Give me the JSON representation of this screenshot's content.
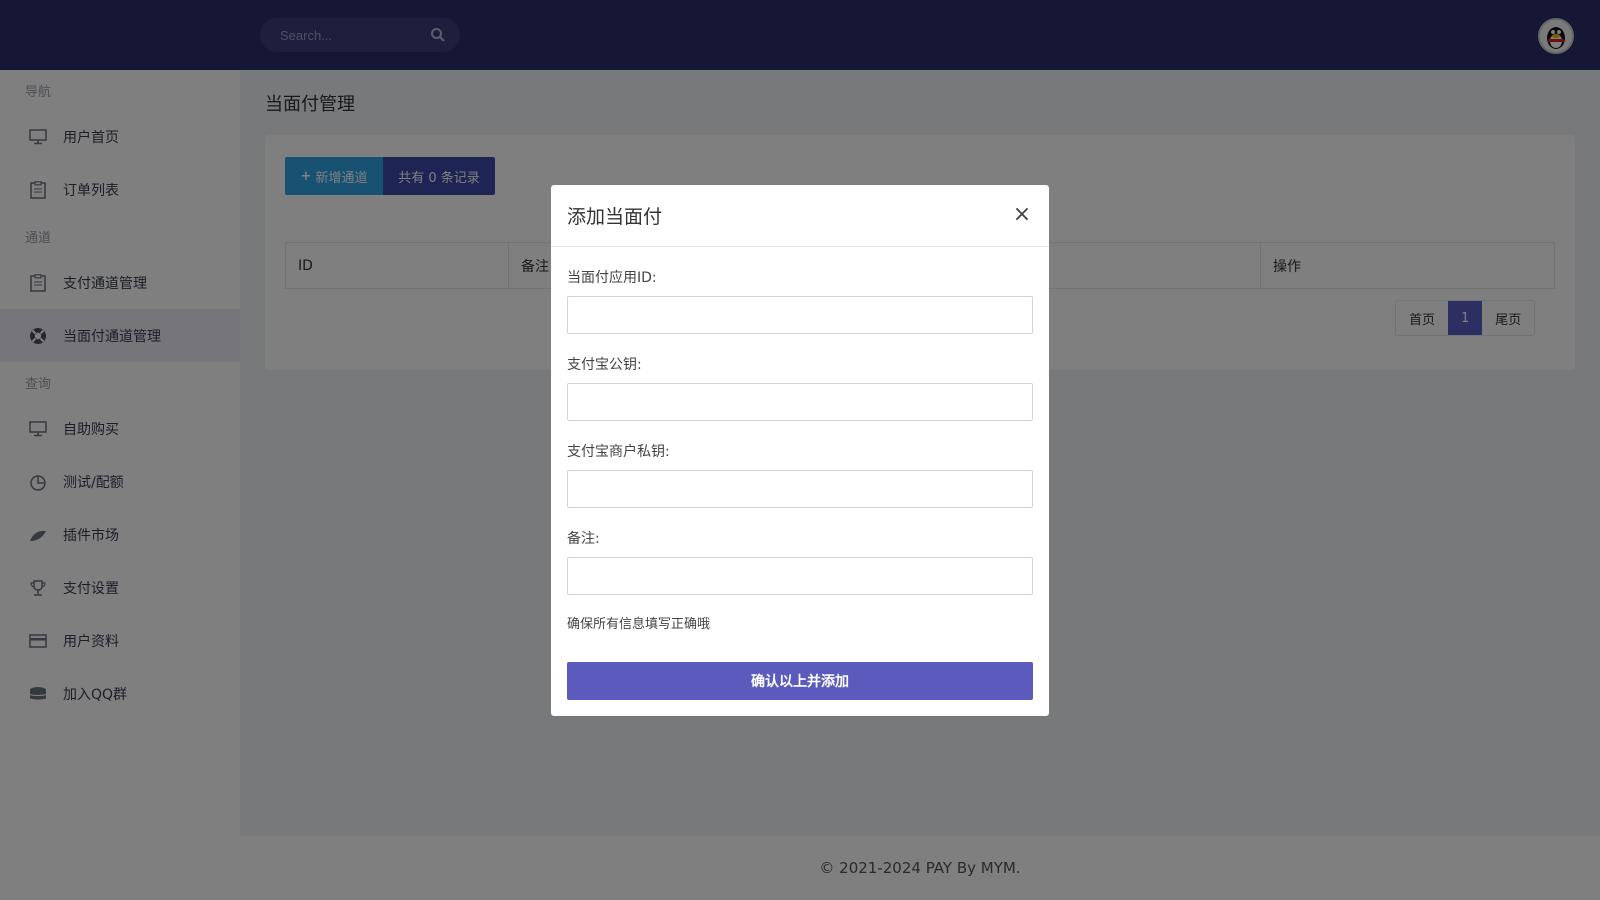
{
  "header": {
    "search_placeholder": "Search..."
  },
  "sidebar": {
    "sections": [
      {
        "title": "导航"
      },
      {
        "title": "通道"
      },
      {
        "title": "查询"
      }
    ],
    "items": [
      {
        "label": "用户首页",
        "icon": "monitor-icon"
      },
      {
        "label": "订单列表",
        "icon": "clipboard-icon"
      },
      {
        "label": "支付通道管理",
        "icon": "clipboard-icon"
      },
      {
        "label": "当面付通道管理",
        "icon": "lifebuoy-icon",
        "active": true
      },
      {
        "label": "自助购买",
        "icon": "monitor-icon"
      },
      {
        "label": "测试/配额",
        "icon": "pie-chart-icon"
      },
      {
        "label": "插件市场",
        "icon": "leaf-icon"
      },
      {
        "label": "支付设置",
        "icon": "trophy-icon"
      },
      {
        "label": "用户资料",
        "icon": "card-icon"
      },
      {
        "label": "加入QQ群",
        "icon": "database-icon"
      }
    ]
  },
  "main": {
    "page_title": "当面付管理",
    "add_button": "新增通道",
    "record_count": "共有 0 条记录",
    "table_headers": [
      "ID",
      "备注",
      "操作"
    ],
    "pager": {
      "first": "首页",
      "current": "1",
      "last": "尾页"
    }
  },
  "modal": {
    "title": "添加当面付",
    "close": "×",
    "fields": [
      {
        "label": "当面付应用ID:",
        "value": ""
      },
      {
        "label": "支付宝公钥:",
        "value": ""
      },
      {
        "label": "支付宝商户私钥:",
        "value": ""
      },
      {
        "label": "备注:",
        "value": ""
      }
    ],
    "hint": "确保所有信息填写正确哦",
    "submit": "确认以上并添加"
  },
  "footer": {
    "copyright": "© 2021-2024 PAY By MYM."
  },
  "colors": {
    "topbar": "#2c2f6b",
    "accent": "#5b5bbe",
    "add_button": "#2fa4e7",
    "count_button": "#3c4aa8"
  }
}
